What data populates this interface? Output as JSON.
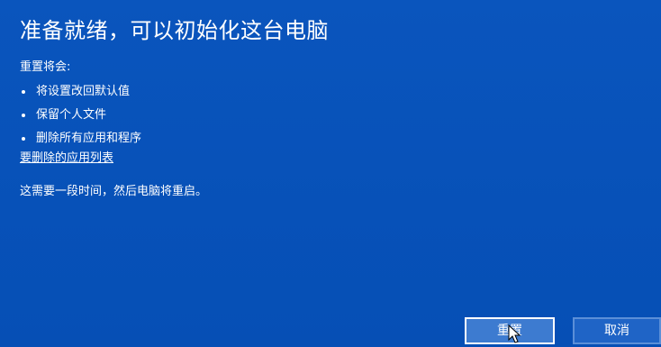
{
  "dialog": {
    "title": "准备就绪，可以初始化这台电脑",
    "subtitle": "重置将会:",
    "bullets": [
      "将设置改回默认值",
      "保留个人文件",
      "删除所有应用和程序"
    ],
    "link": "要删除的应用列表",
    "note": "这需要一段时间，然后电脑将重启。"
  },
  "buttons": {
    "reset_label": "重置",
    "cancel_label": "取消"
  },
  "colors": {
    "background": "#0751b8",
    "text": "#ffffff",
    "primary_button": "#3d7bd0",
    "secondary_button": "#1f64c6"
  },
  "icons": {
    "cursor": "mouse-pointer-icon"
  }
}
